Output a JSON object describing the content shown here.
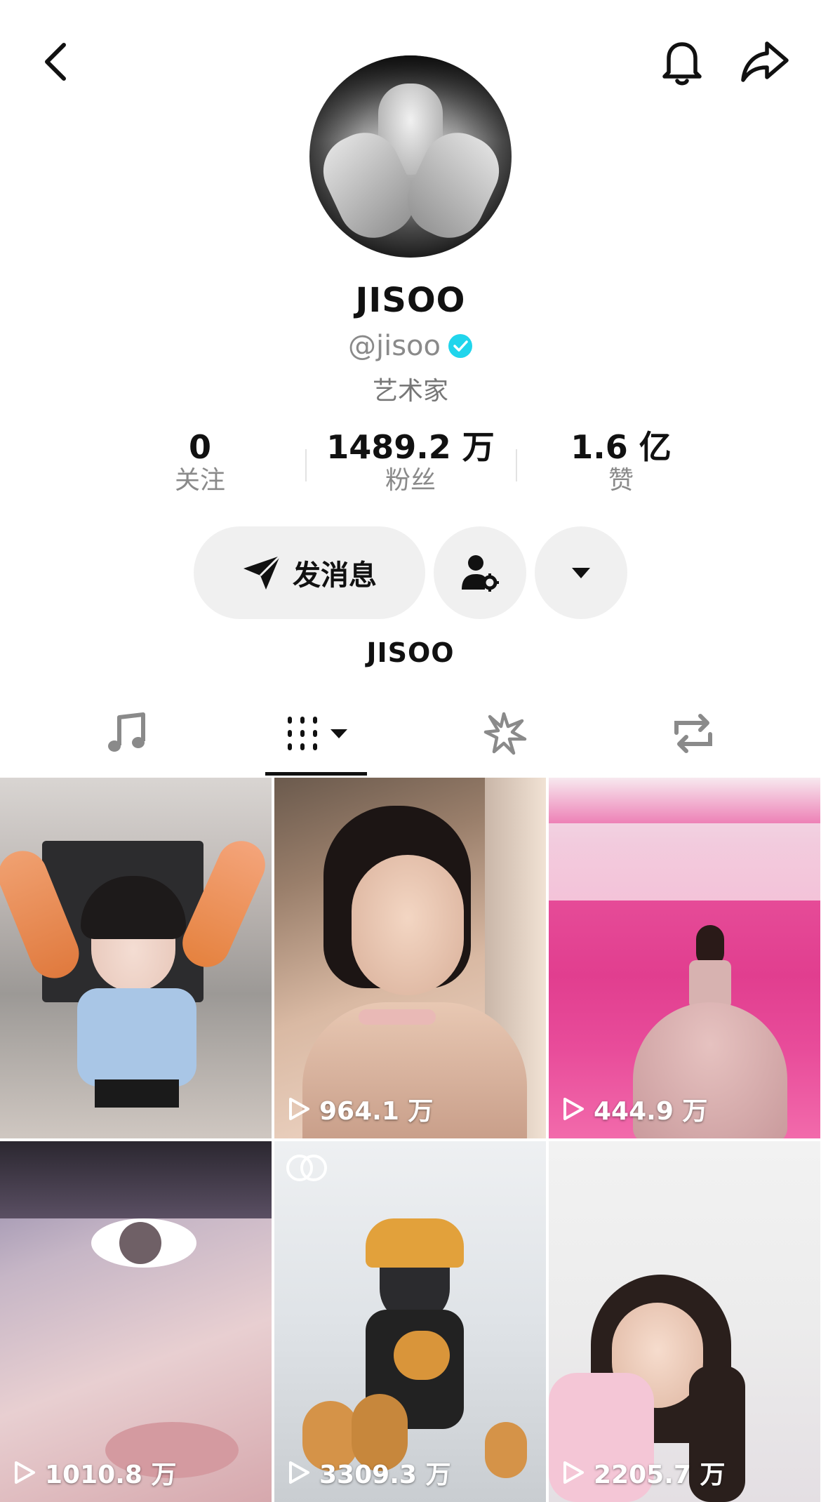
{
  "profile": {
    "name": "JISOO",
    "handle": "@jisoo",
    "role": "艺术家",
    "bio": "JISOO"
  },
  "stats": {
    "following": {
      "value": "0",
      "label": "关注"
    },
    "followers": {
      "value": "1489.2 万",
      "label": "粉丝"
    },
    "likes": {
      "value": "1.6 亿",
      "label": "赞"
    }
  },
  "actions": {
    "message_label": "发消息"
  },
  "tabs": [
    {
      "icon": "music-note-icon"
    },
    {
      "icon": "video-grid-icon"
    },
    {
      "icon": "effects-icon"
    },
    {
      "icon": "repost-icon"
    }
  ],
  "videos": [
    {
      "views": ""
    },
    {
      "views": "964.1 万"
    },
    {
      "views": "444.9 万"
    },
    {
      "views": "1010.8 万"
    },
    {
      "views": "3309.3 万"
    },
    {
      "views": "2205.7 万"
    }
  ],
  "colors": {
    "verified": "#20D5EC",
    "accent_dark": "#111111",
    "muted_text": "#8a8a8a"
  }
}
